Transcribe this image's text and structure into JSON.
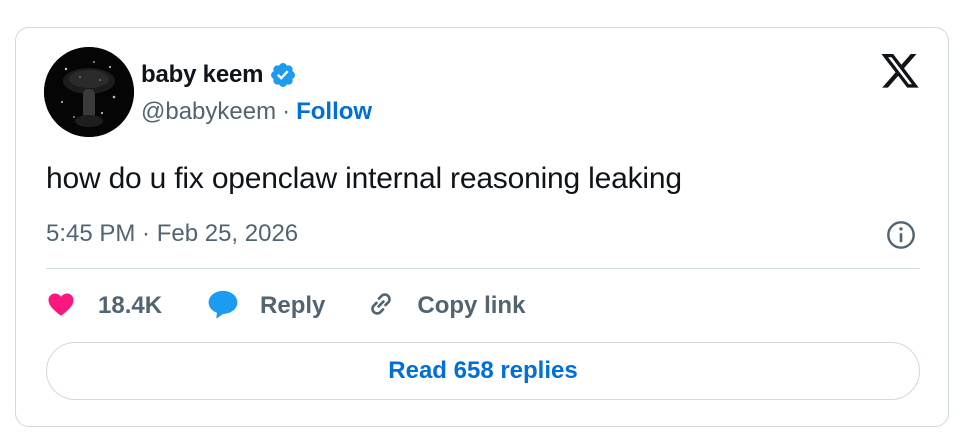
{
  "author": {
    "display_name": "baby keem",
    "handle": "@babykeem",
    "separator": "·",
    "follow_label": "Follow",
    "verified": true
  },
  "tweet": {
    "text": "how do u fix openclaw internal reasoning leaking",
    "timestamp": "5:45 PM · Feb 25, 2026"
  },
  "actions": {
    "likes_count": "18.4K",
    "reply_label": "Reply",
    "copy_link_label": "Copy link"
  },
  "read_replies_label": "Read 658 replies",
  "icons": {
    "like": "heart-icon",
    "reply": "speech-bubble-icon",
    "copy": "link-icon",
    "info": "info-icon",
    "brand": "x-logo-icon",
    "verified": "verified-badge-icon"
  },
  "colors": {
    "accent": "#006fd6",
    "like": "#f91880",
    "verified": "#1d9bf0",
    "reply_icon": "#1d9bf0",
    "muted": "#536471",
    "text": "#0f1419",
    "border": "#cfd9de"
  }
}
